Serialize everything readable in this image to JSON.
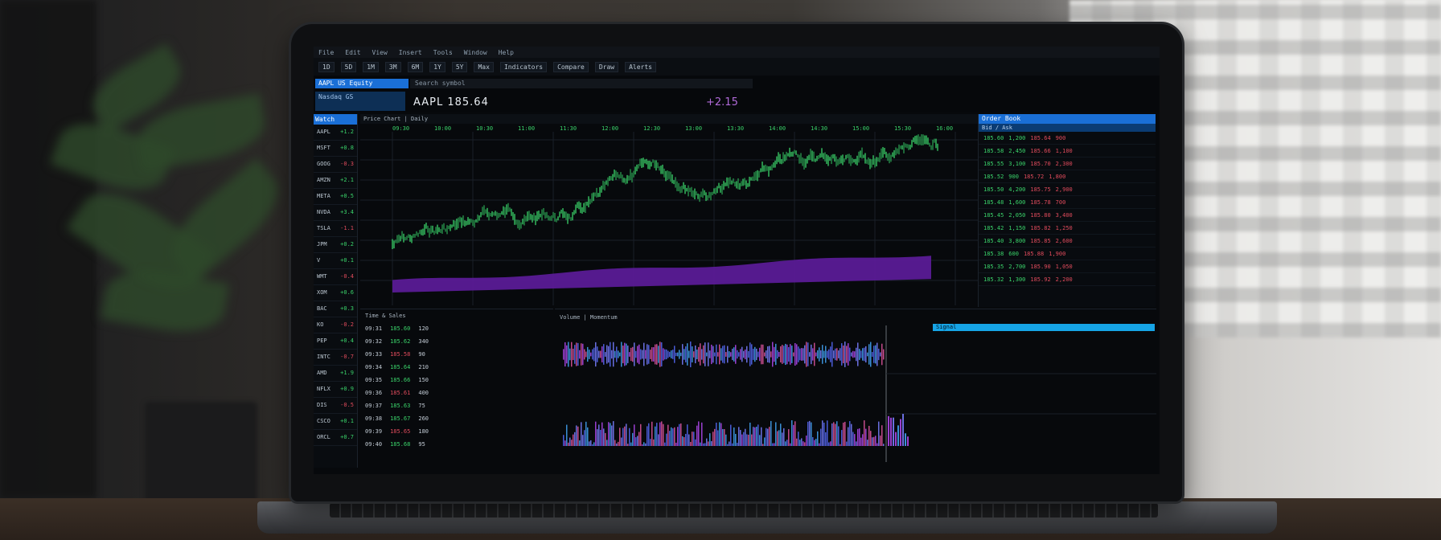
{
  "app": {
    "menu": [
      "File",
      "Edit",
      "View",
      "Insert",
      "Tools",
      "Window",
      "Help"
    ],
    "toolbar": [
      "1D",
      "5D",
      "1M",
      "3M",
      "6M",
      "1Y",
      "5Y",
      "Max",
      "Indicators",
      "Compare",
      "Draw",
      "Alerts"
    ],
    "symbol_tab": "AAPL US Equity",
    "symbol_sub": "Nasdaq GS",
    "search_placeholder": "Search symbol",
    "title": "AAPL 185.64",
    "price_change": "+2.15"
  },
  "chart": {
    "header": "Price Chart  |  Daily",
    "tick_labels": [
      "09:30",
      "10:00",
      "10:30",
      "11:00",
      "11:30",
      "12:00",
      "12:30",
      "13:00",
      "13:30",
      "14:00",
      "14:30",
      "15:00",
      "15:30",
      "16:00"
    ],
    "colors": {
      "candle_up": "#3ad36a",
      "candle_down": "#2a9a4f",
      "band": "#5a1b96",
      "grid": "#1a2028"
    }
  },
  "left_panel": {
    "header": "Watch",
    "rows": [
      [
        "AAPL",
        "+1.2"
      ],
      [
        "MSFT",
        "+0.8"
      ],
      [
        "GOOG",
        "-0.3"
      ],
      [
        "AMZN",
        "+2.1"
      ],
      [
        "META",
        "+0.5"
      ],
      [
        "NVDA",
        "+3.4"
      ],
      [
        "TSLA",
        "-1.1"
      ],
      [
        "JPM",
        "+0.2"
      ],
      [
        "V",
        "+0.1"
      ],
      [
        "WMT",
        "-0.4"
      ],
      [
        "XOM",
        "+0.6"
      ],
      [
        "BAC",
        "+0.3"
      ],
      [
        "KO",
        "-0.2"
      ],
      [
        "PEP",
        "+0.4"
      ],
      [
        "INTC",
        "-0.7"
      ],
      [
        "AMD",
        "+1.9"
      ],
      [
        "NFLX",
        "+0.9"
      ],
      [
        "DIS",
        "-0.5"
      ],
      [
        "CSCO",
        "+0.1"
      ],
      [
        "ORCL",
        "+0.7"
      ]
    ]
  },
  "right_panel": {
    "header": "Order Book",
    "sub": "Bid / Ask",
    "rows": [
      [
        "185.60",
        "1,200",
        "185.64",
        "900"
      ],
      [
        "185.58",
        "2,450",
        "185.66",
        "1,100"
      ],
      [
        "185.55",
        "3,100",
        "185.70",
        "2,300"
      ],
      [
        "185.52",
        "900",
        "185.72",
        "1,800"
      ],
      [
        "185.50",
        "4,200",
        "185.75",
        "2,900"
      ],
      [
        "185.48",
        "1,600",
        "185.78",
        "700"
      ],
      [
        "185.45",
        "2,050",
        "185.80",
        "3,400"
      ],
      [
        "185.42",
        "1,150",
        "185.82",
        "1,250"
      ],
      [
        "185.40",
        "3,800",
        "185.85",
        "2,600"
      ],
      [
        "185.38",
        "600",
        "185.88",
        "1,900"
      ],
      [
        "185.35",
        "2,700",
        "185.90",
        "1,050"
      ],
      [
        "185.32",
        "1,300",
        "185.92",
        "2,200"
      ]
    ]
  },
  "bottom_left": {
    "header": "Time & Sales",
    "rows": [
      [
        "09:31",
        "185.60",
        "120"
      ],
      [
        "09:32",
        "185.62",
        "340"
      ],
      [
        "09:33",
        "185.58",
        "90"
      ],
      [
        "09:34",
        "185.64",
        "210"
      ],
      [
        "09:35",
        "185.66",
        "150"
      ],
      [
        "09:36",
        "185.61",
        "400"
      ],
      [
        "09:37",
        "185.63",
        "75"
      ],
      [
        "09:38",
        "185.67",
        "260"
      ],
      [
        "09:39",
        "185.65",
        "180"
      ],
      [
        "09:40",
        "185.68",
        "95"
      ]
    ]
  },
  "bottom_right": {
    "header": "Volume  |  Momentum",
    "cyan_label": "Signal"
  }
}
